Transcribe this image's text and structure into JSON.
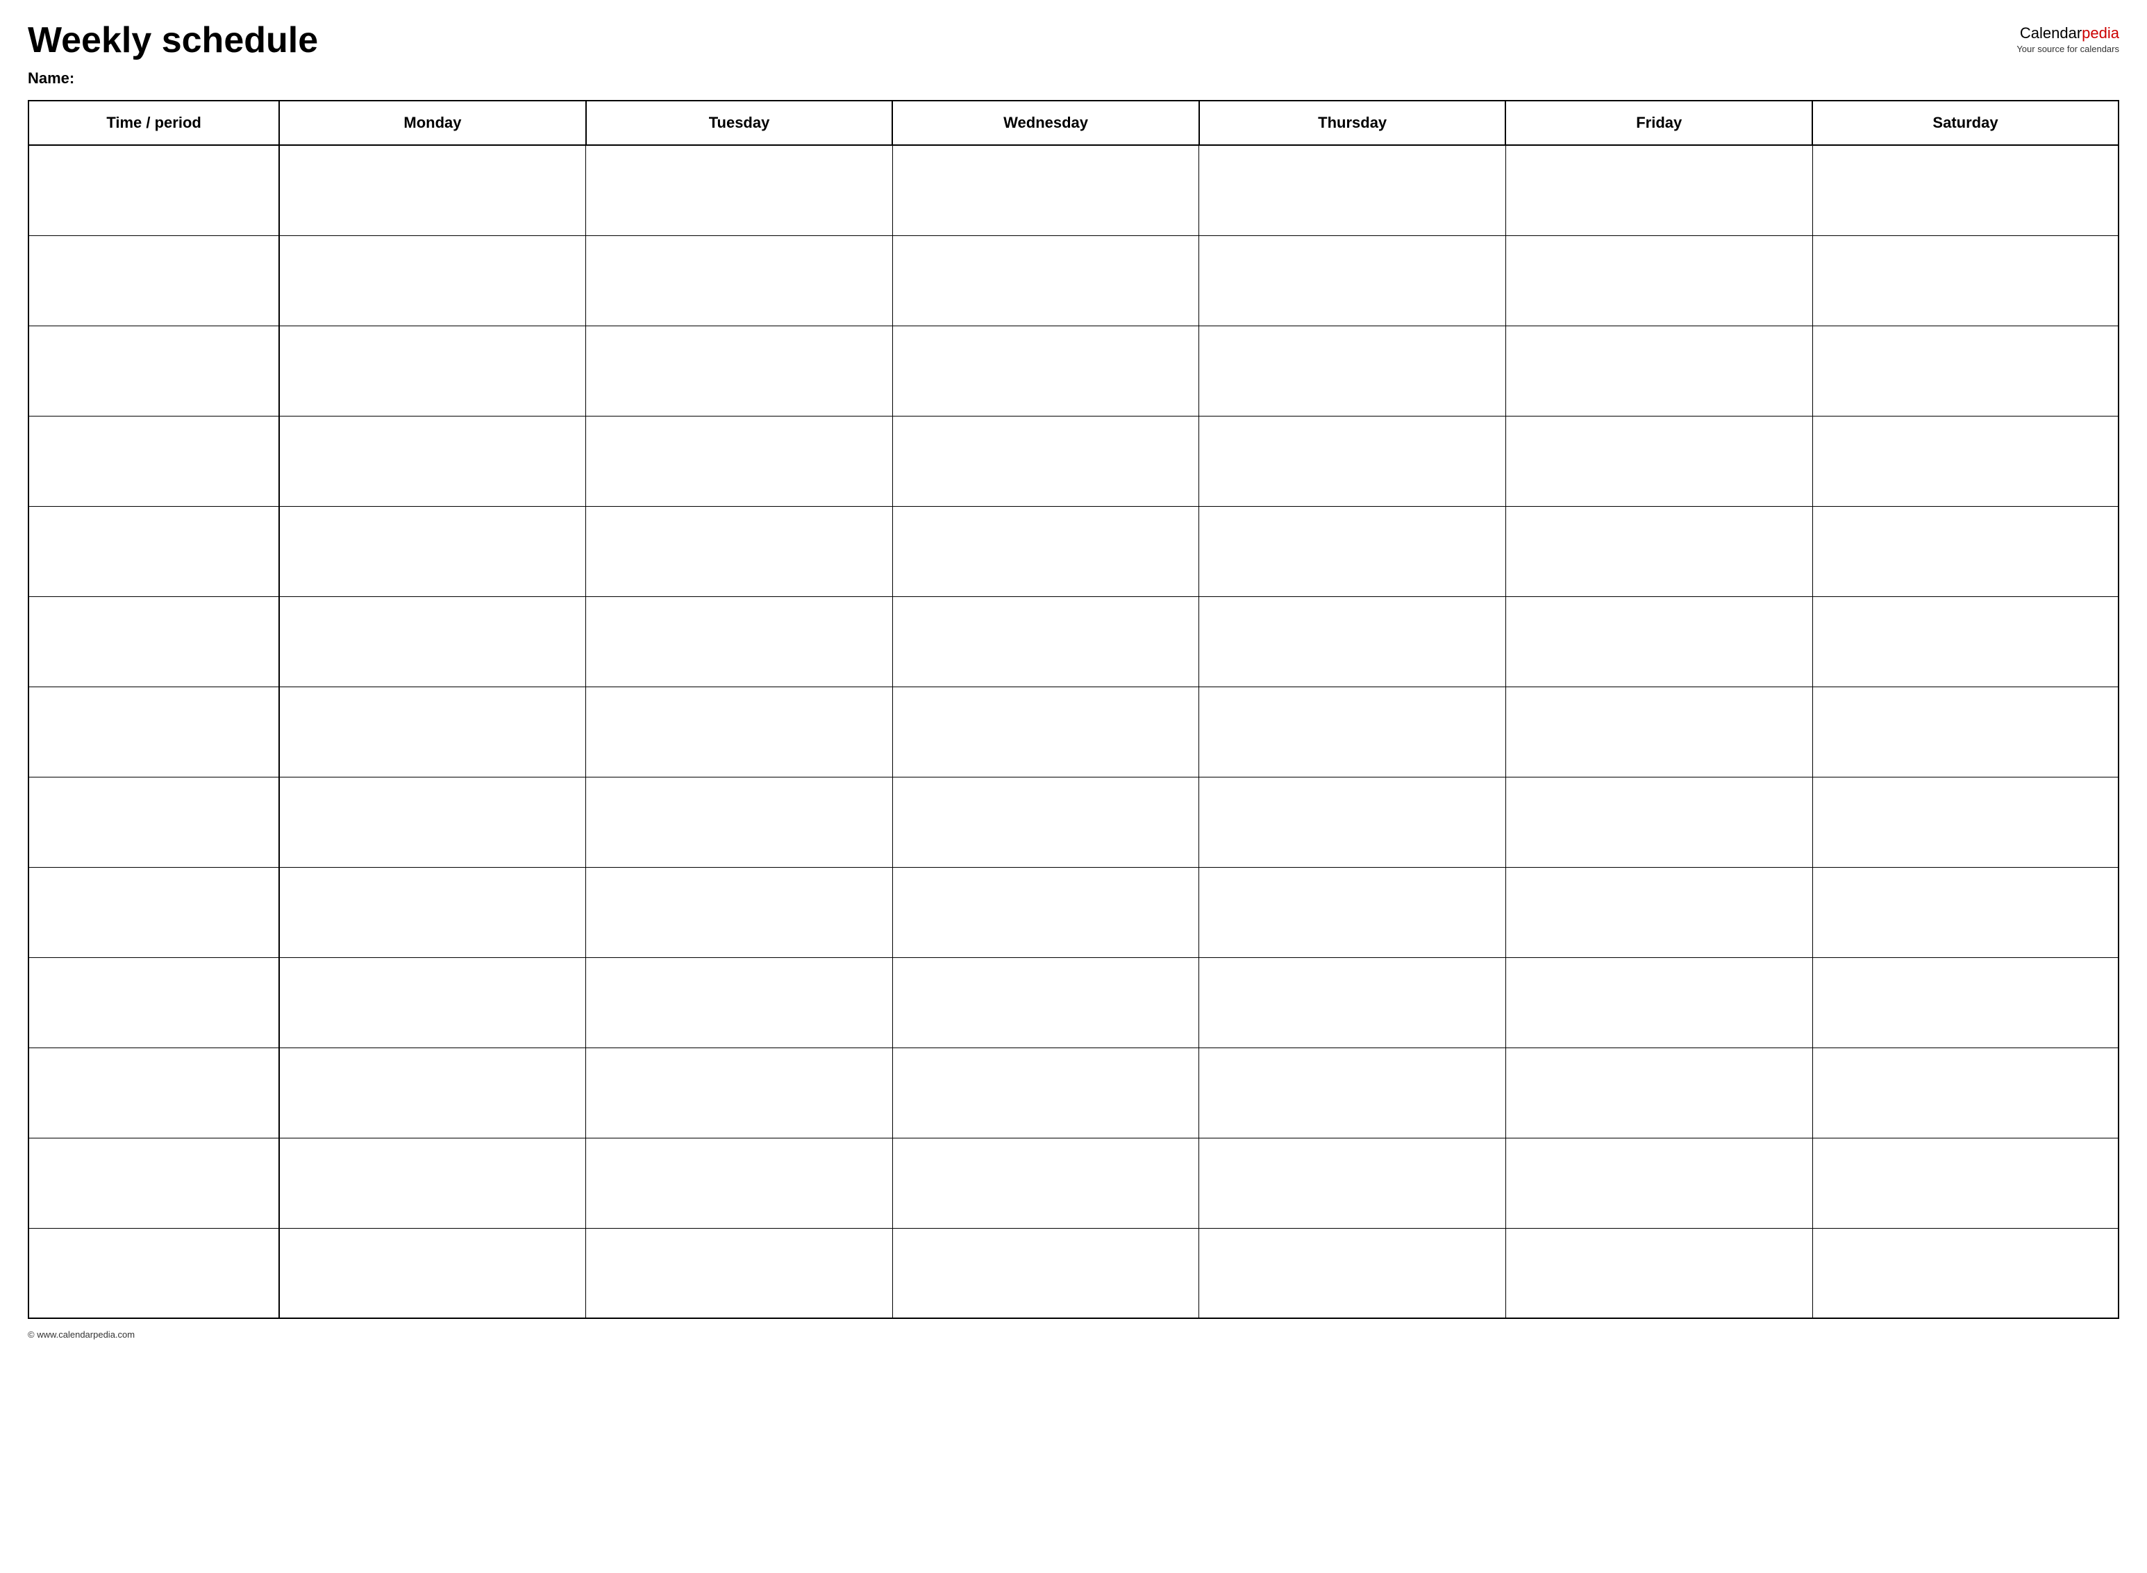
{
  "header": {
    "title": "Weekly schedule",
    "name_label": "Name:",
    "logo": {
      "calendar_part": "Calendar",
      "pedia_part": "pedia",
      "tagline": "Your source for calendars"
    }
  },
  "table": {
    "columns": [
      {
        "id": "time",
        "label": "Time / period"
      },
      {
        "id": "monday",
        "label": "Monday"
      },
      {
        "id": "tuesday",
        "label": "Tuesday"
      },
      {
        "id": "wednesday",
        "label": "Wednesday"
      },
      {
        "id": "thursday",
        "label": "Thursday"
      },
      {
        "id": "friday",
        "label": "Friday"
      },
      {
        "id": "saturday",
        "label": "Saturday"
      }
    ],
    "row_count": 13
  },
  "footer": {
    "copyright": "© www.calendarpedia.com"
  }
}
